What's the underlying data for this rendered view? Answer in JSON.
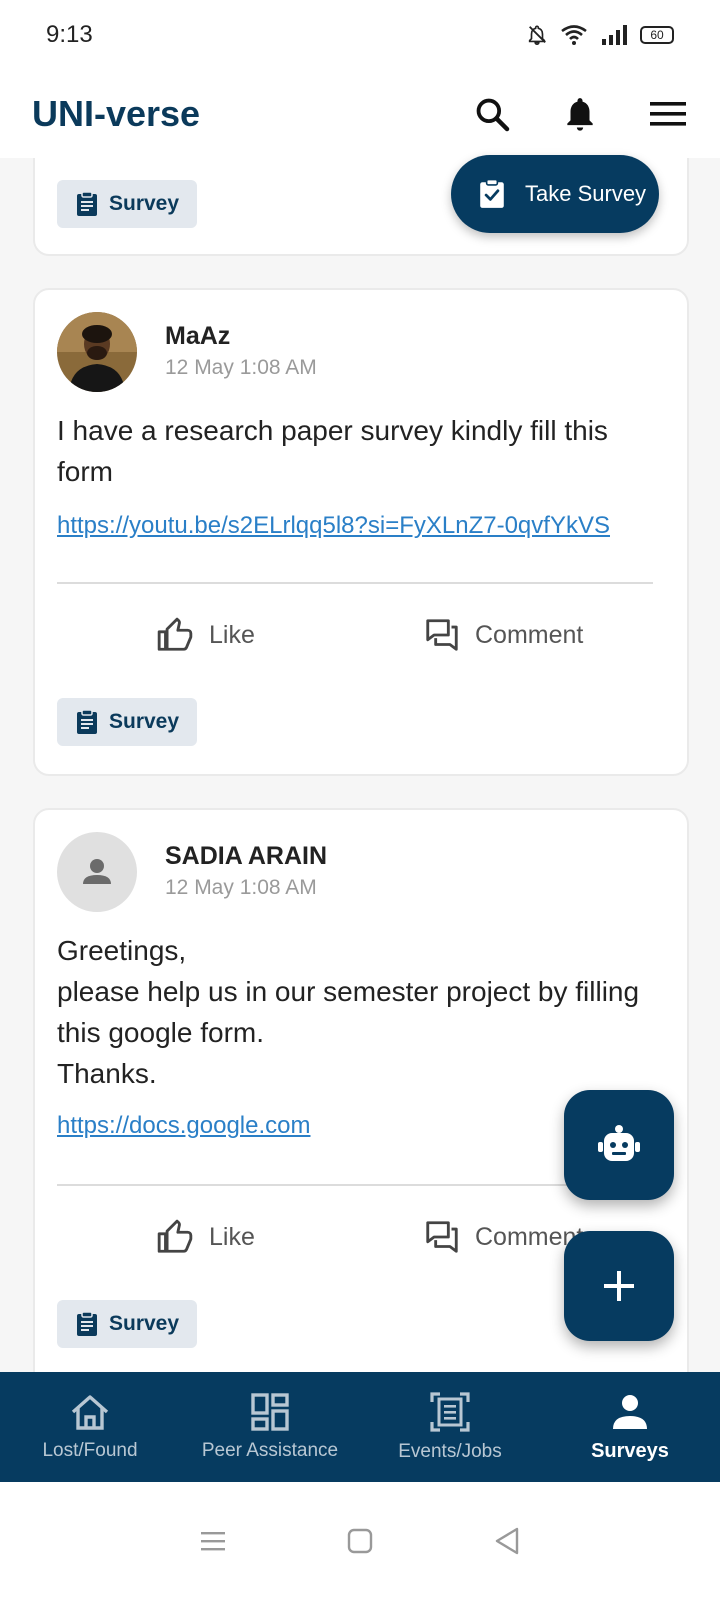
{
  "status_bar": {
    "time": "9:13",
    "battery": "60"
  },
  "app_bar": {
    "title": "UNI-verse"
  },
  "take_survey": {
    "label": "Take Survey"
  },
  "posts": [
    {
      "tag": "Survey"
    },
    {
      "author": "MaAz",
      "time": "12 May 1:08 AM",
      "text": "I have a research paper survey kindly fill this form",
      "link": "https://youtu.be/s2ELrlqq5l8?si=FyXLnZ7-0qvfYkVS",
      "like_label": "Like",
      "comment_label": "Comment",
      "tag": "Survey"
    },
    {
      "author": "SADIA ARAIN",
      "time": "12 May 1:08 AM",
      "text": "Greetings,\nplease help us in our semester project by filling this google form.\nThanks.",
      "link": "https://docs.google.com",
      "like_label": "Like",
      "comment_label": "Comment",
      "tag": "Survey"
    }
  ],
  "bottom_nav": [
    {
      "label": "Lost/Found",
      "icon": "home-icon"
    },
    {
      "label": "Peer Assistance",
      "icon": "dashboard-icon"
    },
    {
      "label": "Events/Jobs",
      "icon": "document-scan-icon"
    },
    {
      "label": "Surveys",
      "icon": "person-icon",
      "active": true
    }
  ],
  "colors": {
    "brand": "#063b60",
    "link": "#2a7fc7",
    "chip_bg": "#e3e8ee"
  }
}
